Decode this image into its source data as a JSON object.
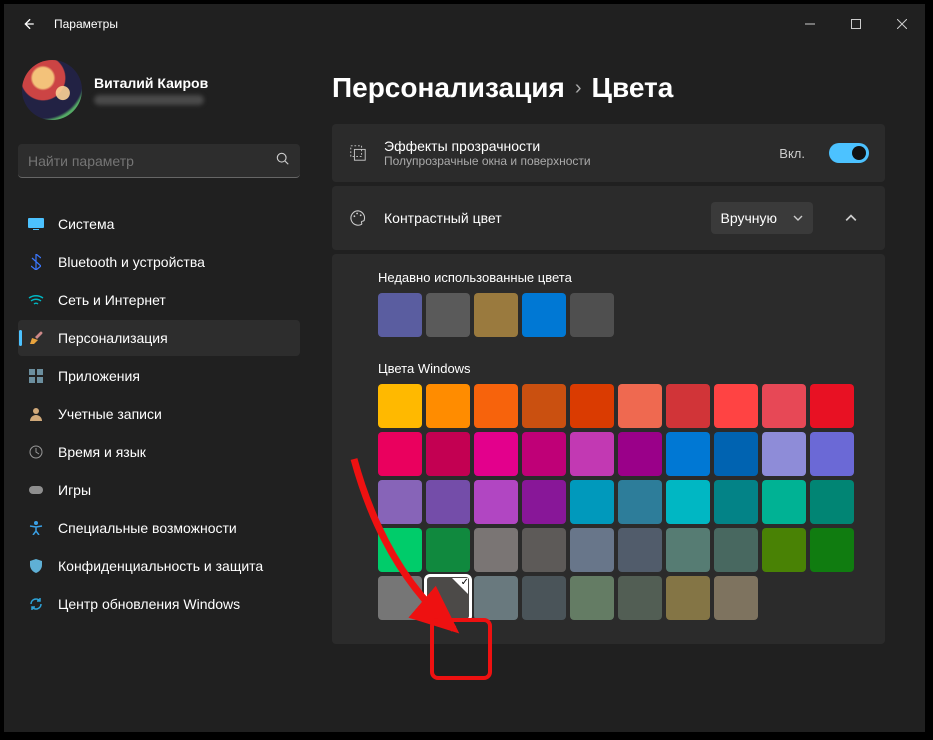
{
  "titlebar": {
    "title": "Параметры"
  },
  "user": {
    "name": "Виталий Каиров"
  },
  "search": {
    "placeholder": "Найти параметр"
  },
  "sidebar": {
    "items": [
      {
        "label": "Система",
        "icon": "system-icon",
        "color": "#4cc2ff"
      },
      {
        "label": "Bluetooth и устройства",
        "icon": "bluetooth-icon",
        "color": "#3b78ff"
      },
      {
        "label": "Сеть и Интернет",
        "icon": "wifi-icon",
        "color": "#00b7c3"
      },
      {
        "label": "Персонализация",
        "icon": "personalization-icon",
        "color": "#e8a33d",
        "active": true
      },
      {
        "label": "Приложения",
        "icon": "apps-icon",
        "color": "#6b8e9e"
      },
      {
        "label": "Учетные записи",
        "icon": "accounts-icon",
        "color": "#d0a97a"
      },
      {
        "label": "Время и язык",
        "icon": "time-language-icon",
        "color": "#8e8e8e"
      },
      {
        "label": "Игры",
        "icon": "gaming-icon",
        "color": "#8e8e8e"
      },
      {
        "label": "Специальные возможности",
        "icon": "accessibility-icon",
        "color": "#3aa0e5"
      },
      {
        "label": "Конфиденциальность и защита",
        "icon": "privacy-icon",
        "color": "#5fb0d6"
      },
      {
        "label": "Центр обновления Windows",
        "icon": "windows-update-icon",
        "color": "#2ea3d8"
      }
    ]
  },
  "breadcrumb": {
    "a": "Персонализация",
    "b": "Цвета"
  },
  "transparency": {
    "title": "Эффекты прозрачности",
    "sub": "Полупрозрачные окна и поверхности",
    "state_label": "Вкл."
  },
  "accent": {
    "title": "Контрастный цвет",
    "combo_value": "Вручную"
  },
  "recent": {
    "label": "Недавно использованные цвета",
    "colors": [
      "#5a5da0",
      "#5a5a5a",
      "#9a7a3e",
      "#0078d4",
      "#4f4f4f"
    ]
  },
  "windows_colors": {
    "label": "Цвета Windows",
    "grid": [
      [
        "#ffb900",
        "#ff8c00",
        "#f7630c",
        "#ca5010",
        "#da3b01",
        "#ef6950",
        "#d13438",
        "#ff4343"
      ],
      [
        "#e74856",
        "#e81123",
        "#ea005e",
        "#c30052",
        "#e3008c",
        "#bf0077",
        "#c239b3",
        "#9a0089"
      ],
      [
        "#0078d4",
        "#0063b1",
        "#8e8cd8",
        "#6b69d6",
        "#8764b8",
        "#744da9",
        "#b146c2",
        "#881798"
      ],
      [
        "#0099bc",
        "#2d7d9a",
        "#00b7c3",
        "#038387",
        "#00b294",
        "#018574",
        "#00cc6a",
        "#10893e"
      ],
      [
        "#7a7574",
        "#5d5a58",
        "#68768a",
        "#515c6b",
        "#567c73",
        "#486860",
        "#498205",
        "#107c10"
      ],
      [
        "#767676",
        "#4c4a48",
        "#69797e",
        "#4a5459",
        "#647c64",
        "#525e54",
        "#847545",
        "#7e735f"
      ]
    ],
    "selected_index": [
      5,
      1
    ]
  }
}
